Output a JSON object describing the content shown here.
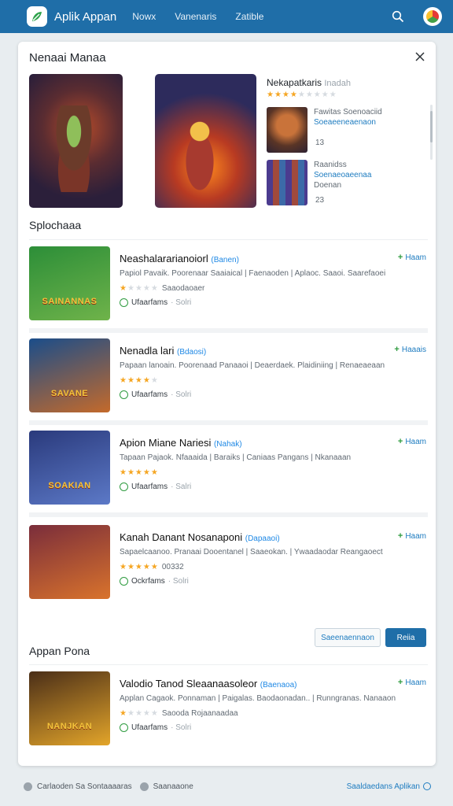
{
  "header": {
    "brand": "Aplik Appan",
    "nav": [
      "Nowx",
      "Vanenaris",
      "Zatible"
    ]
  },
  "dialog": {
    "title": "Nenaai Manaa",
    "side_title": "Nekapatkaris",
    "side_title_muted": "Inadah",
    "side_rating": 3.5,
    "side_items": [
      {
        "line1": "Fawitas Soenoaciid",
        "line2": "Soeaeeneaenaon",
        "count": "13"
      },
      {
        "line1": "Raanidss",
        "line2": "Soenaeoaeenaa",
        "line3": "Doenan",
        "count": "23"
      }
    ]
  },
  "sections": {
    "main": "Splochaaa",
    "second": "Appan Pona"
  },
  "apps": [
    {
      "title": "Neashalararianoiorl",
      "tag": "(Banen)",
      "desc": "Papiol Pavaik.  Poorenaar Saaiaical | Faenaoden | Aplaoc. Saaoi. Saarefaoei",
      "rating": 0.5,
      "extra": "Saaodaoaer",
      "status": "Ufaarfams",
      "status_muted": "Solri",
      "badge": "Haam",
      "thumb_text": "SAINANNAS",
      "colors": [
        "#2c8e38",
        "#6fb34a"
      ]
    },
    {
      "title": "Nenadla lari",
      "tag": "(Bdaosi)",
      "desc": "Papaan lanoain.  Poorenaad Panaaoi | Deaerdaek.  Plaidiniing | Renaeaeaan",
      "rating": 3.5,
      "extra": "",
      "status": "Ufaarfams",
      "status_muted": "Solri",
      "badge": "Haaais",
      "thumb_text": "SAVANE",
      "colors": [
        "#1a4d8a",
        "#c46a2b"
      ]
    },
    {
      "title": "Apion Miane Nariesi",
      "tag": "(Nahak)",
      "desc": "Tapaan Pajaok.  Nfaaaida | Baraiks | Caniaas Pangans | Nkanaaan",
      "rating": 4.5,
      "extra": "",
      "status": "Ufaarfams",
      "status_muted": "Salri",
      "badge": "Haam",
      "thumb_text": "SOAKIAN",
      "colors": [
        "#2a3a7c",
        "#5c79c7"
      ]
    },
    {
      "title": "Kanah Danant Nosanaponi",
      "tag": "(Dapaaoi)",
      "desc": "Sapaelcaanoo.  Pranaai Dooentanel | Saaeokan. | Ywaadaodar Reangaoect",
      "rating": 4.5,
      "extra": "00332",
      "status": "Ockrfams",
      "status_muted": "Solri",
      "badge": "Haam",
      "thumb_text": "",
      "colors": [
        "#7a2d3b",
        "#d9732c"
      ]
    },
    {
      "title": "Valodio Tanod Sleaanaasoleor",
      "tag": "(Baenaoa)",
      "desc": "Applan Cagaok.  Ponnaman | Paigalas. Baodaonadan.. | Runngranas.  Nanaaon",
      "rating": 0.5,
      "extra": "Saooda Rojaanaadaa",
      "status": "Ufaarfams",
      "status_muted": "Solri",
      "badge": "Haam",
      "thumb_text": "NANJKAN",
      "colors": [
        "#4a2e18",
        "#e3a52a"
      ]
    }
  ],
  "buttons": {
    "secondary": "Saeenaennaon",
    "primary": "Reiia"
  },
  "footer": {
    "left1": "Carlaoden Sa Sontaaaaras",
    "left2": "Saanaaone",
    "right": "Saaldaedans  Aplikan"
  },
  "colors": {
    "primary": "#1f6ea8",
    "link": "#1e7cc0",
    "star": "#f5a623",
    "success": "#2e9b3f"
  }
}
